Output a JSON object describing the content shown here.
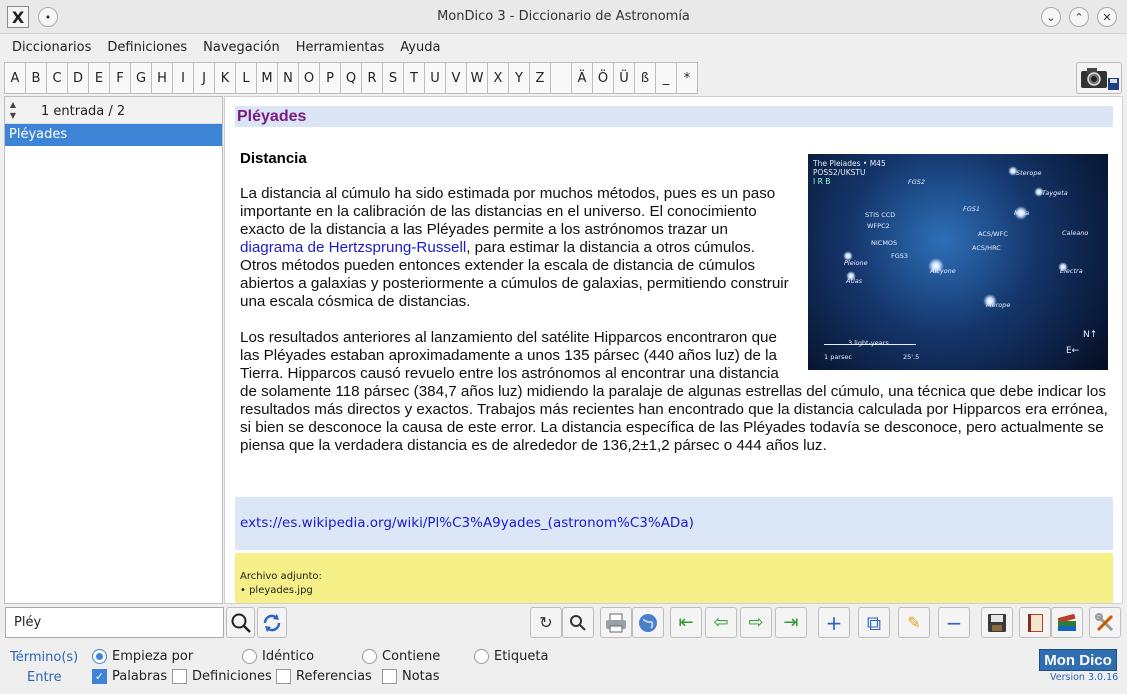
{
  "window": {
    "title": "MonDico 3 - Diccionario de Astronomía",
    "app_icon": "X"
  },
  "menu": [
    "Diccionarios",
    "Definiciones",
    "Navegación",
    "Herramientas",
    "Ayuda"
  ],
  "alphabet": [
    "A",
    "B",
    "C",
    "D",
    "E",
    "F",
    "G",
    "H",
    "I",
    "J",
    "K",
    "L",
    "M",
    "N",
    "O",
    "P",
    "Q",
    "R",
    "S",
    "T",
    "U",
    "V",
    "W",
    "X",
    "Y",
    "Z",
    "",
    "Ä",
    "Ö",
    "Ü",
    "ß",
    "_",
    "*"
  ],
  "list": {
    "count": "1 entrada / 2",
    "items": [
      "Pléyades"
    ]
  },
  "entry": {
    "title": "Pléyades",
    "section": "Distancia",
    "p1_a": "La distancia al cúmulo ha sido estimada por muchos métodos, pues es un paso importante en la calibración de las distancias en el universo. El conocimiento exacto de la distancia a las Pléyades permite a los astrónomos trazar un ",
    "p1_link": "diagrama de Hertzsprung-Russell",
    "p1_b": ", para estimar la distancia a otros cúmulos. Otros métodos pueden entonces extender la escala de distancia de cúmulos abiertos a galaxias y posteriormente a cúmulos de galaxias, permitiendo construir una escala cósmica de distancias.",
    "p2": "Los resultados anteriores al lanzamiento del satélite Hipparcos encontraron que las Pléyades estaban aproximadamente a unos 135 pársec (440 años luz) de la Tierra. Hipparcos causó revuelo entre los astrónomos al encontrar una distancia de solamente 118 pársec (384,7 años luz) midiendo la paralaje de algunas estrellas del cúmulo, una técnica que debe indicar los resultados más directos y exactos. Trabajos más recientes han encontrado que la distancia calculada por Hipparcos era errónea, si bien se desconoce la causa de este error. La distancia específica de las Pléyades todavía se desconoce, pero actualmente se piensa que la verdadera distancia es de alrededor de 136,2±1,2 pársec o 444 años luz.",
    "image_caption_1": "The Pleiades • M45",
    "image_caption_2": "POSS2/UKSTU",
    "image_caption_3": "I R B",
    "star_labels": [
      "Sterope",
      "Taygeta",
      "Maia",
      "Caleano",
      "Electra",
      "Alcyone",
      "Merope",
      "Pleione",
      "Atlas",
      "FGS2",
      "FGS1",
      "STIS CCD",
      "WFPC2",
      "NICMOS",
      "FGS3",
      "ACS/WFC",
      "ACS/HRC"
    ],
    "scale_label": "3 light-years",
    "scale_parsec": "1 parsec",
    "scale_arcmin": "25'.5",
    "wiki_link": "exts://es.wikipedia.org/wiki/Pl%C3%A9yades_(astronom%C3%ADa)",
    "attachment_label": "Archivo adjunto:",
    "attachment_file": "• pleyades.jpg"
  },
  "search": {
    "value": "Pléy"
  },
  "options": {
    "termino_label": "Término(s)",
    "entre_label": "Entre",
    "radios": [
      {
        "label": "Empieza por",
        "checked": true
      },
      {
        "label": "Idéntico",
        "checked": false
      },
      {
        "label": "Contiene",
        "checked": false
      },
      {
        "label": "Etiqueta",
        "checked": false
      }
    ],
    "checks": [
      {
        "label": "Palabras",
        "checked": true
      },
      {
        "label": "Definiciones",
        "checked": false
      },
      {
        "label": "Referencias",
        "checked": false
      },
      {
        "label": "Notas",
        "checked": false
      }
    ]
  },
  "brand": {
    "logo": "Mon Dico",
    "version": "Version 3.0.16"
  }
}
